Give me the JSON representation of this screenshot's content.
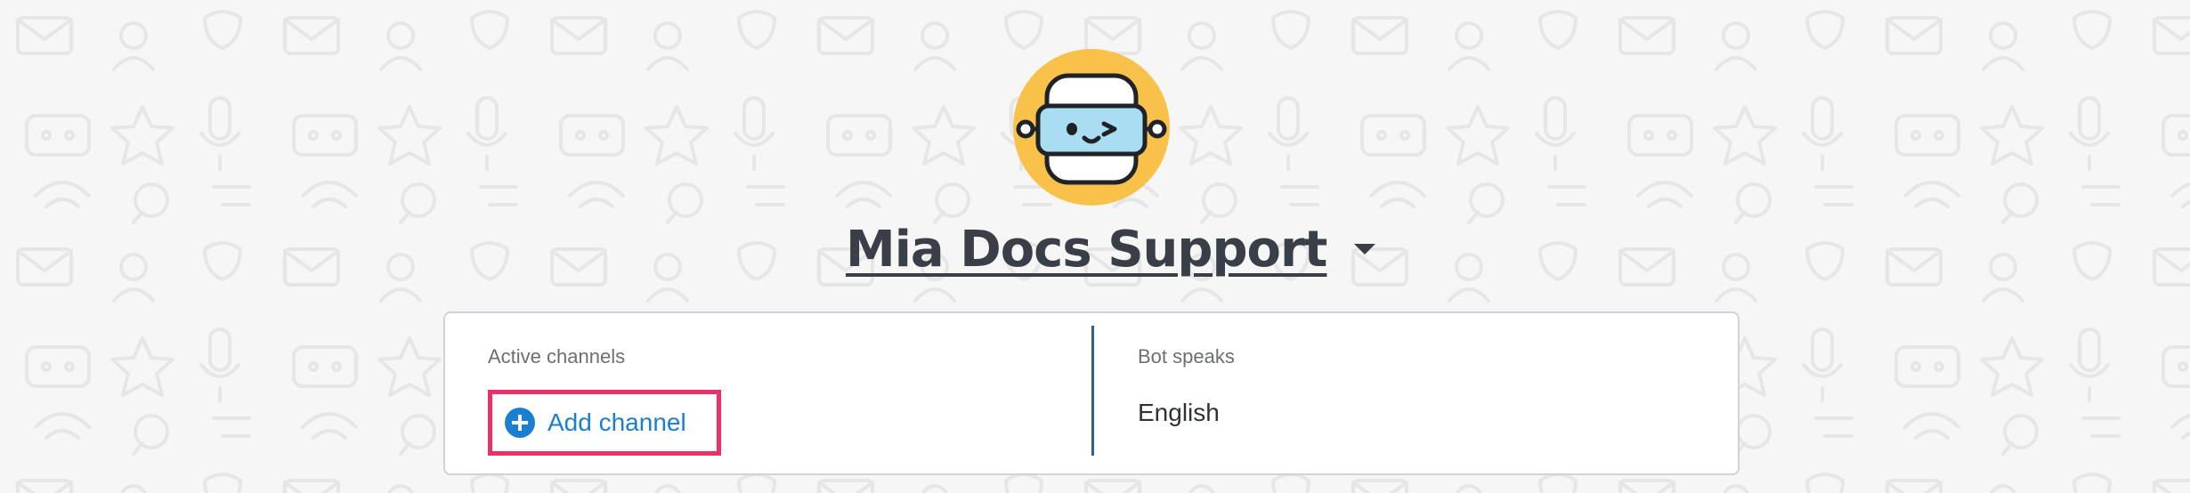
{
  "bot": {
    "name": "Mia Docs Support",
    "avatar_icon": "robot-avatar-icon",
    "avatar_color": "#f8c24a",
    "dropdown_icon": "caret-down-icon"
  },
  "channels": {
    "label": "Active channels",
    "add_label": "Add channel",
    "add_icon": "plus-circle-icon",
    "accent_color": "#1a7fd1",
    "highlight_color": "#e8336a"
  },
  "language": {
    "label": "Bot speaks",
    "value": "English"
  }
}
